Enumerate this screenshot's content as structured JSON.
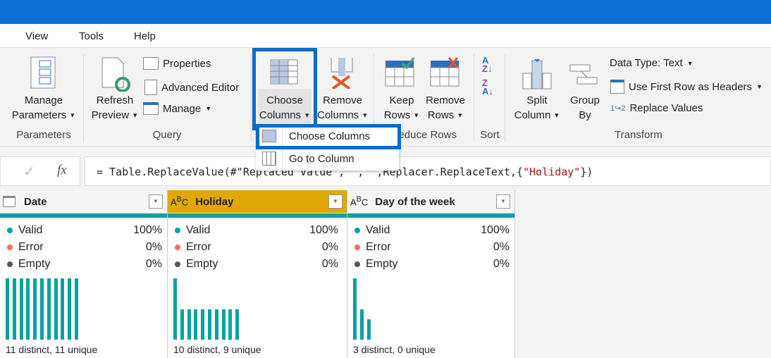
{
  "menu": [
    "View",
    "Tools",
    "Help"
  ],
  "ribbon": {
    "manage_parameters": [
      "Manage",
      "Parameters"
    ],
    "refresh_preview": [
      "Refresh",
      "Preview"
    ],
    "properties": "Properties",
    "advanced_editor": "Advanced Editor",
    "manage": "Manage",
    "choose_columns": [
      "Choose",
      "Columns"
    ],
    "remove_columns": [
      "Remove",
      "Columns"
    ],
    "keep_rows": [
      "Keep",
      "Rows"
    ],
    "remove_rows": [
      "Remove",
      "Rows"
    ],
    "split_column": [
      "Split",
      "Column"
    ],
    "group_by": [
      "Group",
      "By"
    ],
    "data_type": "Data Type: Text",
    "first_row_headers": "Use First Row as Headers",
    "replace_values": "Replace Values",
    "groups": {
      "parameters": "Parameters",
      "query": "Query",
      "reduce_rows": "Reduce Rows",
      "sort": "Sort",
      "transform": "Transform"
    }
  },
  "dropdown": [
    "Choose Columns",
    "Go to Column"
  ],
  "formula": {
    "fx": "fx",
    "prefix": "= Table.ReplaceValue(#\"Replaced Value\",\"\",\"\",Replacer.ReplaceText,{",
    "string": "\"Holiday\"",
    "suffix": "})"
  },
  "colors": {
    "accent": "#0a70d6",
    "valid": "#07a2a0",
    "error": "#f07060",
    "empty": "#555555",
    "selected_header": "#dfa806"
  },
  "columns": [
    {
      "name": "Date",
      "type_icon": "calendar-icon",
      "valid": "100%",
      "error": "0%",
      "empty": "0%",
      "footer": "11 distinct, 11 unique",
      "distribution": [
        1,
        1,
        1,
        1,
        1,
        1,
        1,
        1,
        1,
        1,
        1
      ]
    },
    {
      "name": "Holiday",
      "type_icon": "ABC",
      "valid": "100%",
      "error": "0%",
      "empty": "0%",
      "footer": "10 distinct, 9 unique",
      "distribution": [
        2,
        1,
        1,
        1,
        1,
        1,
        1,
        1,
        1,
        1
      ]
    },
    {
      "name": "Day of the week",
      "type_icon": "ABC",
      "valid": "100%",
      "error": "0%",
      "empty": "0%",
      "footer": "3 distinct, 0 unique",
      "distribution": [
        6,
        3,
        2
      ]
    }
  ],
  "stat_labels": [
    "Valid",
    "Error",
    "Empty"
  ]
}
